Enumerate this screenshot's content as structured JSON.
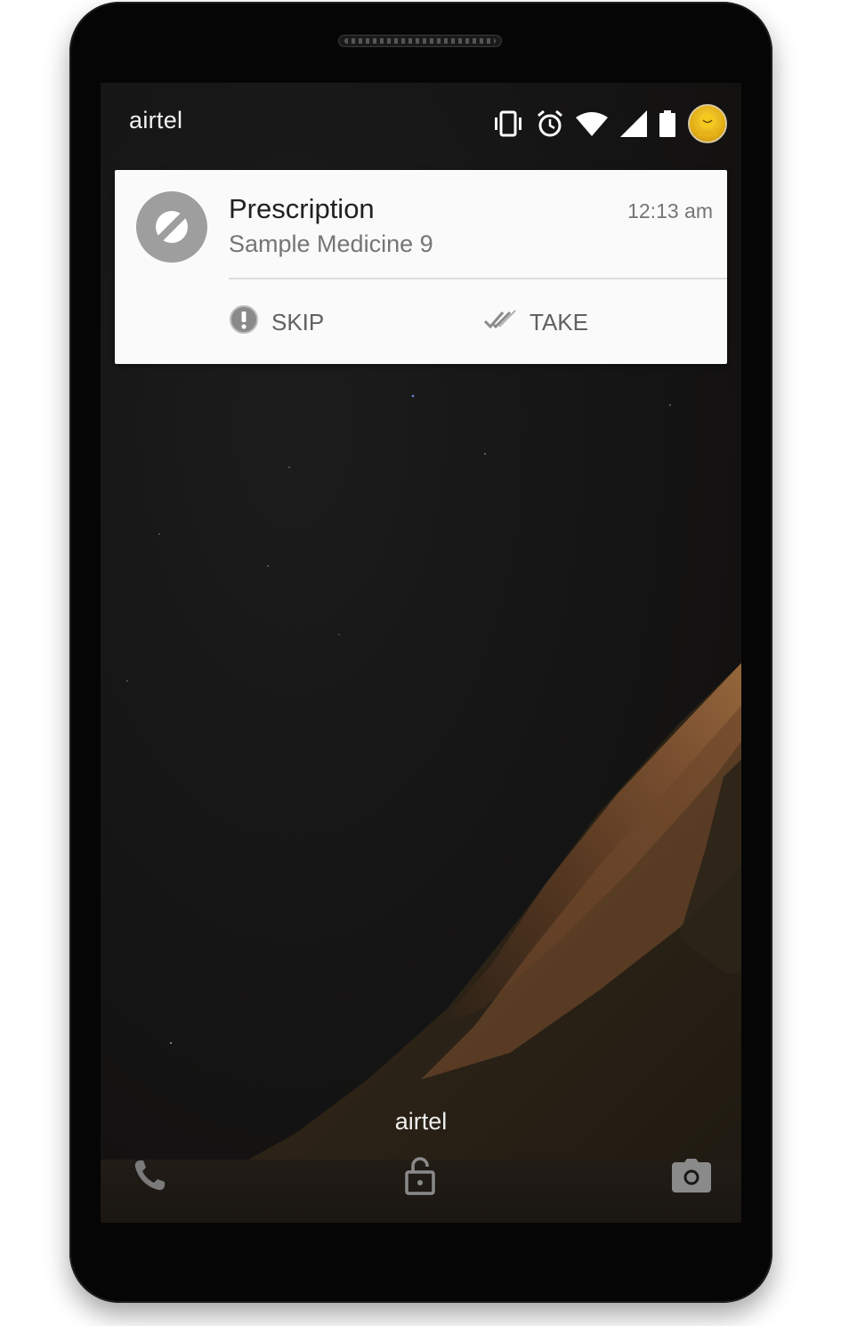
{
  "status_bar": {
    "carrier": "airtel",
    "icons": [
      "vibrate-icon",
      "alarm-icon",
      "wifi-icon",
      "signal-icon",
      "battery-icon",
      "avatar"
    ]
  },
  "notification": {
    "title": "Prescription",
    "text": "Sample Medicine 9",
    "time": "12:13 am",
    "icon": "pill-icon",
    "actions": {
      "skip_label": "SKIP",
      "skip_icon": "alert-circle-icon",
      "take_label": "TAKE",
      "take_icon": "double-check-icon"
    }
  },
  "lockscreen": {
    "carrier": "airtel",
    "shortcuts": [
      "phone-icon",
      "lock-icon",
      "camera-icon"
    ]
  },
  "colors": {
    "notification_bg": "#fafafa",
    "icon_circle": "#9e9e9e",
    "title": "#212121",
    "secondary_text": "#757575",
    "wallpaper_rock": "#8a5a2a"
  }
}
